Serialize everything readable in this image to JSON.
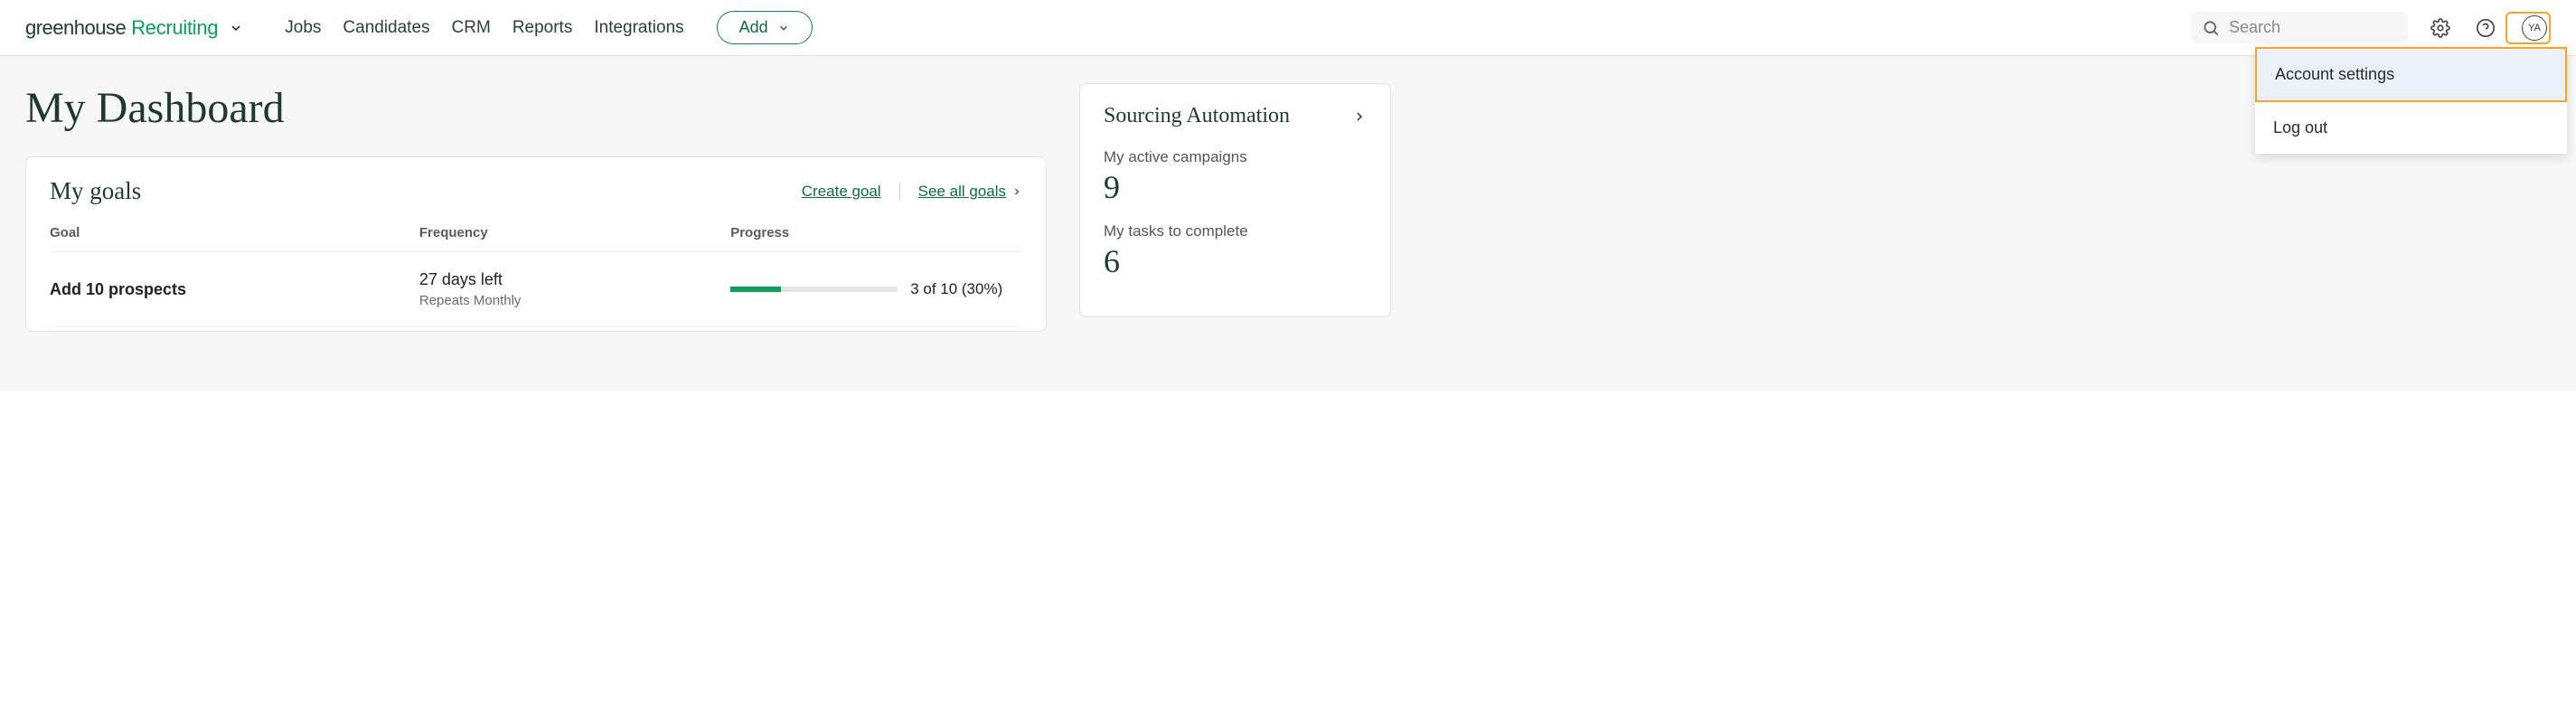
{
  "logo": {
    "part1": "greenhouse",
    "part2": "Recruiting"
  },
  "nav": {
    "jobs": "Jobs",
    "candidates": "Candidates",
    "crm": "CRM",
    "reports": "Reports",
    "integrations": "Integrations"
  },
  "add_button": "Add",
  "search": {
    "placeholder": "Search"
  },
  "avatar_initials": "YA",
  "dropdown": {
    "account_settings": "Account settings",
    "log_out": "Log out"
  },
  "page_title": "My Dashboard",
  "goals_card": {
    "title": "My goals",
    "create_goal": "Create goal",
    "see_all": "See all goals",
    "columns": {
      "goal": "Goal",
      "frequency": "Frequency",
      "progress": "Progress"
    },
    "rows": [
      {
        "name": "Add 10 prospects",
        "freq_main": "27 days left",
        "freq_sub": "Repeats Monthly",
        "progress_pct": 30,
        "progress_text": "3 of 10 (30%)"
      }
    ]
  },
  "sourcing_card": {
    "title": "Sourcing Automation",
    "stats": [
      {
        "label": "My active campaigns",
        "value": "9"
      },
      {
        "label": "My tasks to complete",
        "value": "6"
      }
    ]
  },
  "colors": {
    "accent_green": "#0ba05a",
    "highlight_orange": "#f5a623"
  }
}
